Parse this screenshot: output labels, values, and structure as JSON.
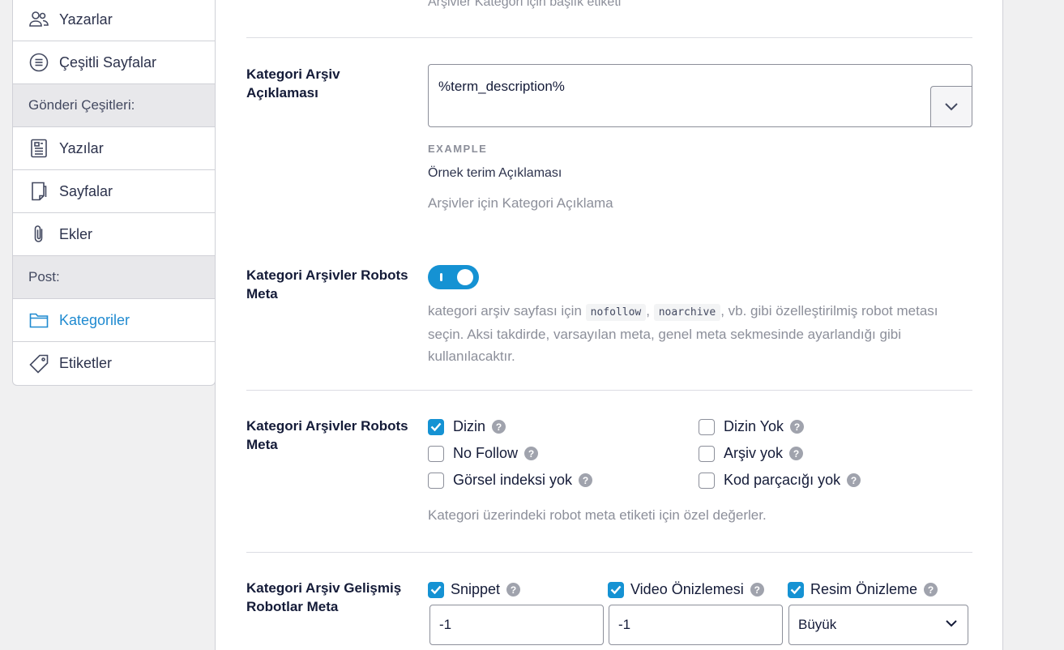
{
  "sidebar": {
    "items": [
      {
        "label": "Yazarlar",
        "icon": "users-icon",
        "type": "item"
      },
      {
        "label": "Çeşitli Sayfalar",
        "icon": "list-circle-icon",
        "type": "item"
      },
      {
        "label": "Gönderi Çeşitleri:",
        "type": "heading"
      },
      {
        "label": "Yazılar",
        "icon": "document-icon",
        "type": "item"
      },
      {
        "label": "Sayfalar",
        "icon": "page-icon",
        "type": "item"
      },
      {
        "label": "Ekler",
        "icon": "paperclip-icon",
        "type": "item"
      },
      {
        "label": "Post:",
        "type": "heading"
      },
      {
        "label": "Kategoriler",
        "icon": "folder-icon",
        "type": "item",
        "active": true
      },
      {
        "label": "Etiketler",
        "icon": "tag-icon",
        "type": "item"
      }
    ]
  },
  "top_partial_text": "Arşivler Kategori için başlık etiketi",
  "description_row": {
    "label": "Kategori Arşiv Açıklaması",
    "value": "%term_description%",
    "example_title": "EXAMPLE",
    "example_value": "Örnek terim Açıklaması",
    "help": "Arşivler için Kategori Açıklama"
  },
  "robots_toggle_row": {
    "label": "Kategori Arşivler Robots Meta",
    "toggle_on": true,
    "desc_before": "kategori arşiv sayfası için",
    "code1": "nofollow",
    "sep": ",",
    "code2": "noarchive",
    "desc_after": ", vb. gibi özelleştirilmiş robot metası seçin. Aksi takdirde, varsayılan meta, genel meta sekmesinde ayarlandığı gibi kullanılacaktır."
  },
  "robots_checkbox_row": {
    "label": "Kategori Arşivler Robots Meta",
    "options": [
      {
        "label": "Dizin",
        "checked": true
      },
      {
        "label": "No Follow",
        "checked": false
      },
      {
        "label": "Görsel indeksi yok",
        "checked": false
      },
      {
        "label": "Dizin Yok",
        "checked": false
      },
      {
        "label": "Arşiv yok",
        "checked": false
      },
      {
        "label": "Kod parçacığı yok",
        "checked": false
      }
    ],
    "help": "Kategori üzerindeki robot meta etiketi için özel değerler."
  },
  "advanced_row": {
    "label": "Kategori Arşiv Gelişmiş Robotlar Meta",
    "options": [
      {
        "label": "Snippet",
        "checked": true,
        "value": "-1"
      },
      {
        "label": "Video Önizlemesi",
        "checked": true,
        "value": "-1"
      },
      {
        "label": "Resim Önizleme",
        "checked": true,
        "value": "Büyük"
      }
    ]
  },
  "colors": {
    "accent": "#1592d3",
    "muted": "#8c8f9a",
    "text": "#141b38"
  }
}
